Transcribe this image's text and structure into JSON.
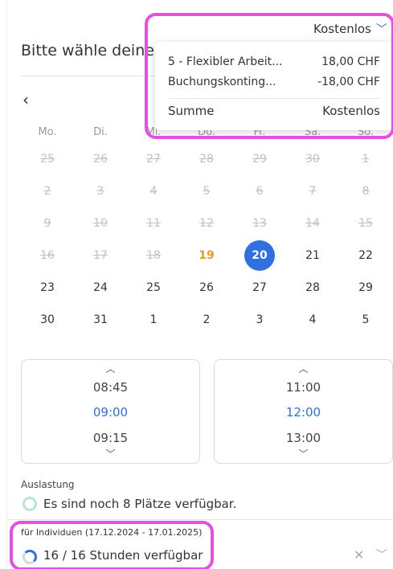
{
  "header": {
    "title": "Bitte wähle deine",
    "price_toggle_label": "Kostenlos"
  },
  "price_popup": {
    "rows": [
      {
        "label": "5 - Flexibler Arbeit...",
        "value": "18,00 CHF"
      },
      {
        "label": "Buchungskonting...",
        "value": "-18,00 CHF"
      }
    ],
    "total": {
      "label": "Summe",
      "value": "Kostenlos"
    }
  },
  "calendar": {
    "weekdays": [
      "Mo.",
      "Di.",
      "Mi.",
      "Do.",
      "Fr.",
      "Sa.",
      "So."
    ],
    "rows": [
      [
        "25",
        "26",
        "27",
        "28",
        "29",
        "30",
        "1"
      ],
      [
        "2",
        "3",
        "4",
        "5",
        "6",
        "7",
        "8"
      ],
      [
        "9",
        "10",
        "11",
        "12",
        "13",
        "14",
        "15"
      ],
      [
        "16",
        "17",
        "18",
        "19",
        "20",
        "21",
        "22"
      ],
      [
        "23",
        "24",
        "25",
        "26",
        "27",
        "28",
        "29"
      ],
      [
        "30",
        "31",
        "1",
        "2",
        "3",
        "4",
        "5"
      ]
    ],
    "today": "19",
    "selected": "20"
  },
  "time_start": {
    "prev": "08:45",
    "current": "09:00",
    "next": "09:15"
  },
  "time_end": {
    "prev": "11:00",
    "current": "12:00",
    "next": "13:00"
  },
  "occupancy": {
    "label": "Auslastung",
    "text": "Es sind noch 8 Plätze verfügbar."
  },
  "quota": {
    "label": "für Individuen (17.12.2024 - 17.01.2025)",
    "text": "16 / 16 Stunden verfügbar"
  },
  "colors": {
    "accent": "#2f6fe0",
    "today": "#e89b1a",
    "highlight": "#e64fe0",
    "occupancy_ring": "#b7e6d5"
  }
}
